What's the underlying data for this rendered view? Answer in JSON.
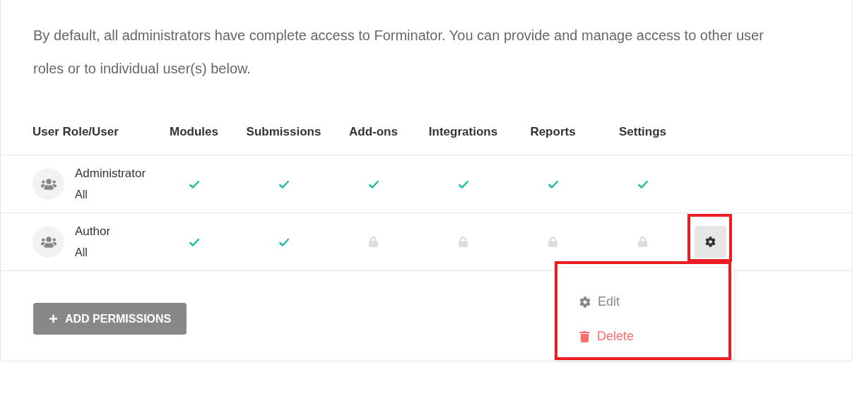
{
  "intro": "By default, all administrators have complete access to Forminator. You can provide and manage access to other user roles or to individual user(s) below.",
  "table": {
    "columns": [
      "User Role/User",
      "Modules",
      "Submissions",
      "Add-ons",
      "Integrations",
      "Reports",
      "Settings"
    ],
    "rows": [
      {
        "name": "Administrator",
        "scope": "All",
        "access": [
          true,
          true,
          true,
          true,
          true,
          true
        ],
        "menu_button": false
      },
      {
        "name": "Author",
        "scope": "All",
        "access": [
          true,
          true,
          false,
          false,
          false,
          false
        ],
        "menu_button": true
      }
    ]
  },
  "dropdown": {
    "items": [
      {
        "kind": "edit",
        "label": "Edit"
      },
      {
        "kind": "delete",
        "label": "Delete"
      }
    ]
  },
  "add_button": {
    "label": "ADD PERMISSIONS"
  }
}
